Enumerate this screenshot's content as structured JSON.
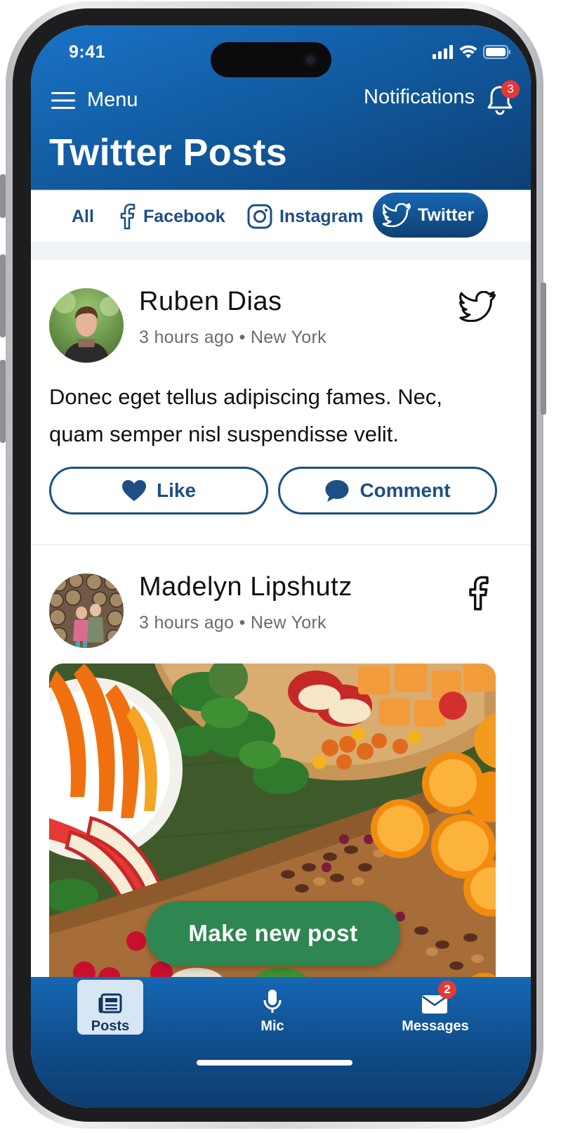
{
  "status_bar": {
    "time": "9:41"
  },
  "header": {
    "menu_label": "Menu",
    "notifications_label": "Notifications",
    "notifications_count": "3",
    "title": "Twitter Posts"
  },
  "tabs": [
    {
      "label": "All",
      "icon": "none",
      "active": false
    },
    {
      "label": "Facebook",
      "icon": "facebook-icon",
      "active": false
    },
    {
      "label": "Instagram",
      "icon": "instagram-icon",
      "active": false
    },
    {
      "label": "Twitter",
      "icon": "twitter-icon",
      "active": true
    }
  ],
  "posts": [
    {
      "author": "Ruben Dias",
      "time": "3 hours ago",
      "location": "New York",
      "platform": "twitter-icon",
      "body": "Donec eget tellus adipiscing fames. Nec, quam semper nisl suspendisse velit.",
      "like_label": "Like",
      "comment_label": "Comment"
    },
    {
      "author": "Madelyn Lipshutz",
      "time": "3 hours ago",
      "location": "New York",
      "platform": "facebook-icon",
      "image": "food-platter-photo"
    }
  ],
  "fab_label": "Make new post",
  "bottom_nav": [
    {
      "label": "Posts",
      "icon": "posts-icon",
      "active": true
    },
    {
      "label": "Mic",
      "icon": "mic-icon",
      "active": false
    },
    {
      "label": "Messages",
      "icon": "mail-icon",
      "active": false,
      "badge": "2"
    }
  ],
  "colors": {
    "header_blue": "#10579b",
    "tab_blue": "#1d4f84",
    "fab_green": "#2e8650",
    "badge_red": "#e53935"
  }
}
